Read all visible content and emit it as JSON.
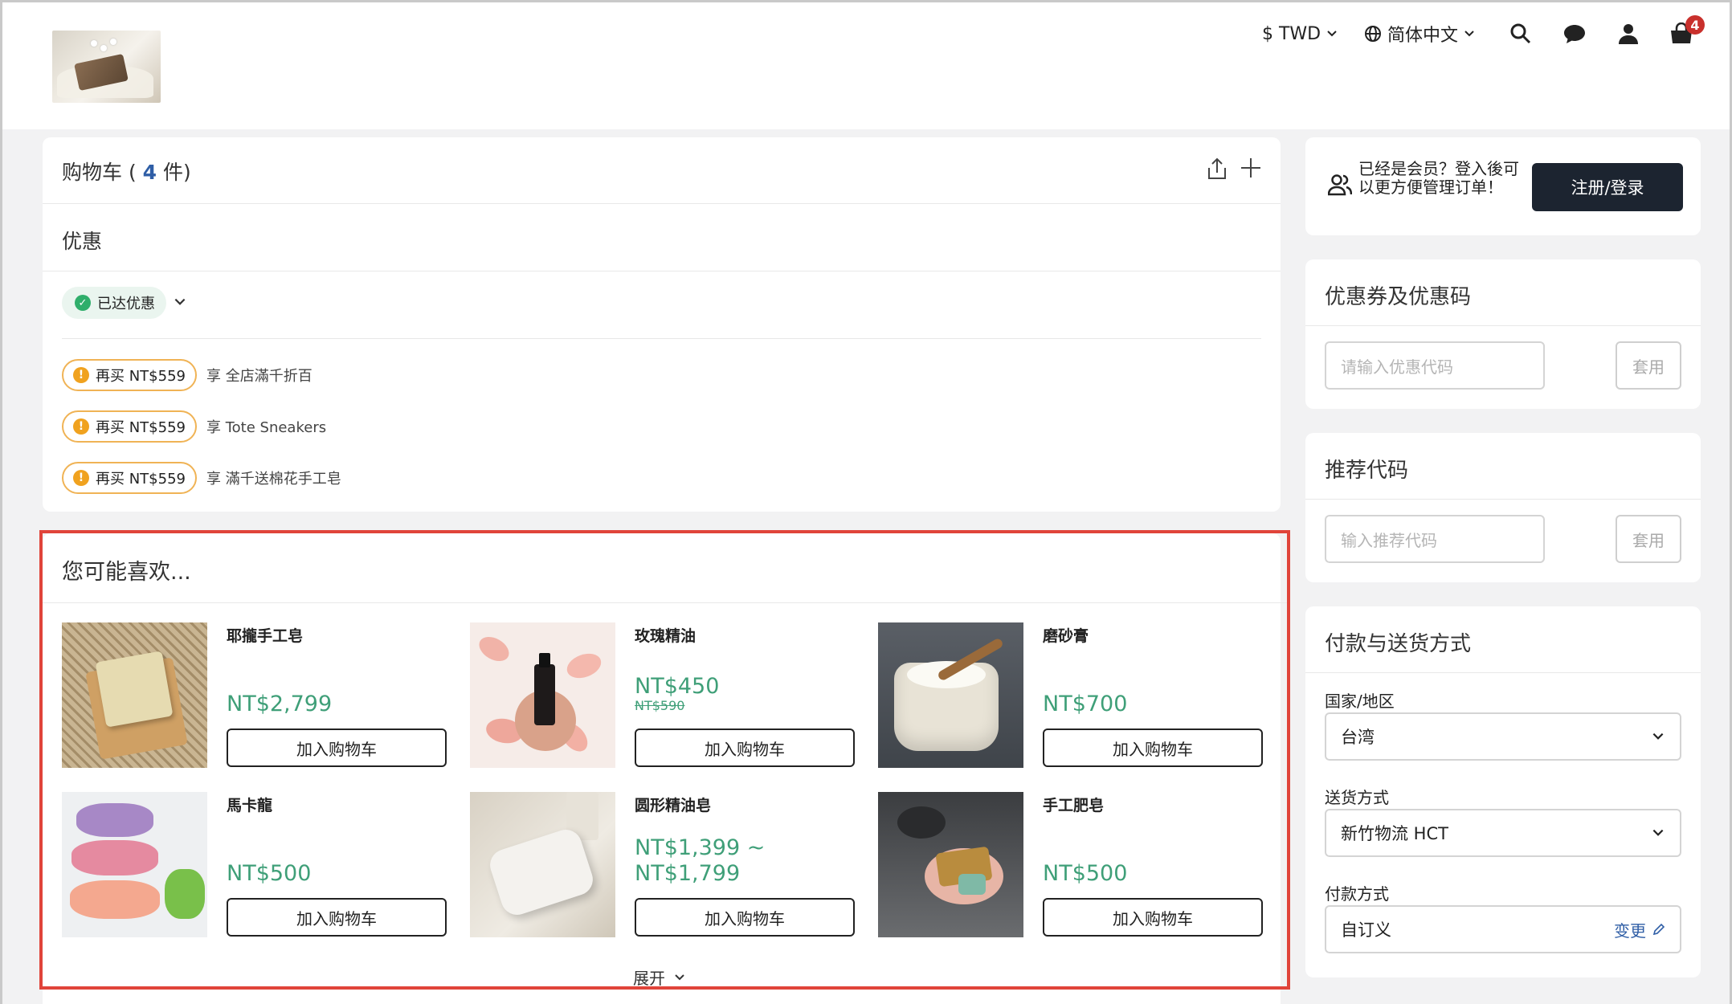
{
  "header": {
    "currency": "$ TWD",
    "language": "简体中文",
    "cart_count": "4"
  },
  "cart": {
    "title_prefix": "购物车 (",
    "count": "4",
    "title_suffix": "件)",
    "promo_section_title": "优惠",
    "achieved_label": "已达优惠",
    "promos": [
      {
        "badge": "再买 NT$559",
        "desc": "享 全店滿千折百"
      },
      {
        "badge": "再买 NT$559",
        "desc": "享 Tote Sneakers"
      },
      {
        "badge": "再买 NT$559",
        "desc": "享 滿千送棉花手工皂"
      }
    ]
  },
  "recommend": {
    "title": "您可能喜欢...",
    "add_to_cart_label": "加入购物车",
    "expand_label": "展开",
    "products": [
      {
        "name": "耶攏手工皂",
        "price": "NT$2,799"
      },
      {
        "name": "玫瑰精油",
        "price": "NT$450",
        "original_price": "NT$590"
      },
      {
        "name": "磨砂膏",
        "price": "NT$700"
      },
      {
        "name": "馬卡龍",
        "price": "NT$500"
      },
      {
        "name": "圆形精油皂",
        "price": "NT$1,399 ~",
        "price2": "NT$1,799"
      },
      {
        "name": "手工肥皂",
        "price": "NT$500"
      }
    ]
  },
  "member": {
    "text": "已经是会员？登入後可以更方便管理订单！",
    "login_button": "注册/登录"
  },
  "coupon": {
    "title": "优惠券及优惠码",
    "placeholder": "请输入优惠代码",
    "apply": "套用"
  },
  "referral": {
    "title": "推荐代码",
    "placeholder": "输入推荐代码",
    "apply": "套用"
  },
  "checkout": {
    "title": "付款与送货方式",
    "country_label": "国家/地区",
    "country_value": "台湾",
    "shipping_label": "送货方式",
    "shipping_value": "新竹物流 HCT",
    "payment_label": "付款方式",
    "payment_value": "自订义",
    "change_label": "变更"
  },
  "colors": {
    "price_green": "#3f9f78",
    "highlight_red": "#e0443a",
    "dark_button": "#1c2430",
    "link_blue": "#2f5ea6"
  }
}
